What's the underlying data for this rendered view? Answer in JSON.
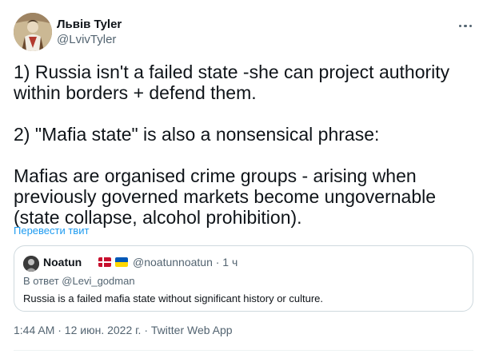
{
  "tweet": {
    "author_name": "Львів Tyler",
    "author_handle": "@LvivTyler",
    "paragraphs": [
      "1) Russia isn't a failed state -she can project authority within borders + defend them.",
      "2) \"Mafia state\" is also a nonsensical phrase:",
      "Mafias are organised crime groups - arising when previously governed markets become ungovernable (state collapse, alcohol prohibition)."
    ],
    "translate_label": "Перевести твит",
    "timestamp": "1:44 AM · 12 июн. 2022 г.",
    "source": "Twitter Web App",
    "more_icon": "more-horizontal-icon"
  },
  "quote": {
    "author_name": "Noatun",
    "flags": [
      "flag-denmark",
      "flag-ukraine"
    ],
    "author_handle": "@noatunnoatun · 1 ч",
    "reply_to": "В ответ @Levi_godman",
    "text": "Russia is a failed mafia state without significant history or culture."
  },
  "colors": {
    "text": "#0f1419",
    "secondary": "#536471",
    "link": "#1d9bf0",
    "border": "#cfd9de"
  }
}
